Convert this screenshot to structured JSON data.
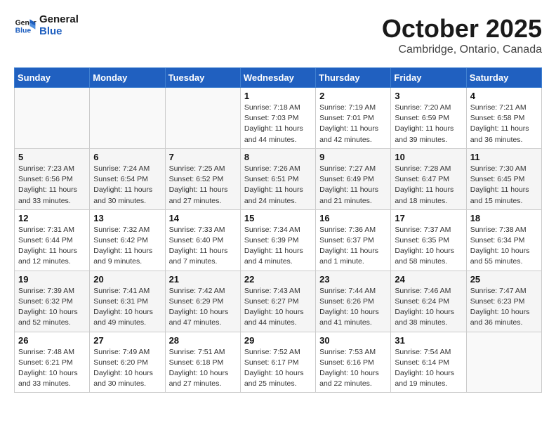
{
  "header": {
    "logo_line1": "General",
    "logo_line2": "Blue",
    "month_title": "October 2025",
    "location": "Cambridge, Ontario, Canada"
  },
  "days_of_week": [
    "Sunday",
    "Monday",
    "Tuesday",
    "Wednesday",
    "Thursday",
    "Friday",
    "Saturday"
  ],
  "weeks": [
    [
      {
        "num": "",
        "info": ""
      },
      {
        "num": "",
        "info": ""
      },
      {
        "num": "",
        "info": ""
      },
      {
        "num": "1",
        "info": "Sunrise: 7:18 AM\nSunset: 7:03 PM\nDaylight: 11 hours and 44 minutes."
      },
      {
        "num": "2",
        "info": "Sunrise: 7:19 AM\nSunset: 7:01 PM\nDaylight: 11 hours and 42 minutes."
      },
      {
        "num": "3",
        "info": "Sunrise: 7:20 AM\nSunset: 6:59 PM\nDaylight: 11 hours and 39 minutes."
      },
      {
        "num": "4",
        "info": "Sunrise: 7:21 AM\nSunset: 6:58 PM\nDaylight: 11 hours and 36 minutes."
      }
    ],
    [
      {
        "num": "5",
        "info": "Sunrise: 7:23 AM\nSunset: 6:56 PM\nDaylight: 11 hours and 33 minutes."
      },
      {
        "num": "6",
        "info": "Sunrise: 7:24 AM\nSunset: 6:54 PM\nDaylight: 11 hours and 30 minutes."
      },
      {
        "num": "7",
        "info": "Sunrise: 7:25 AM\nSunset: 6:52 PM\nDaylight: 11 hours and 27 minutes."
      },
      {
        "num": "8",
        "info": "Sunrise: 7:26 AM\nSunset: 6:51 PM\nDaylight: 11 hours and 24 minutes."
      },
      {
        "num": "9",
        "info": "Sunrise: 7:27 AM\nSunset: 6:49 PM\nDaylight: 11 hours and 21 minutes."
      },
      {
        "num": "10",
        "info": "Sunrise: 7:28 AM\nSunset: 6:47 PM\nDaylight: 11 hours and 18 minutes."
      },
      {
        "num": "11",
        "info": "Sunrise: 7:30 AM\nSunset: 6:45 PM\nDaylight: 11 hours and 15 minutes."
      }
    ],
    [
      {
        "num": "12",
        "info": "Sunrise: 7:31 AM\nSunset: 6:44 PM\nDaylight: 11 hours and 12 minutes."
      },
      {
        "num": "13",
        "info": "Sunrise: 7:32 AM\nSunset: 6:42 PM\nDaylight: 11 hours and 9 minutes."
      },
      {
        "num": "14",
        "info": "Sunrise: 7:33 AM\nSunset: 6:40 PM\nDaylight: 11 hours and 7 minutes."
      },
      {
        "num": "15",
        "info": "Sunrise: 7:34 AM\nSunset: 6:39 PM\nDaylight: 11 hours and 4 minutes."
      },
      {
        "num": "16",
        "info": "Sunrise: 7:36 AM\nSunset: 6:37 PM\nDaylight: 11 hours and 1 minute."
      },
      {
        "num": "17",
        "info": "Sunrise: 7:37 AM\nSunset: 6:35 PM\nDaylight: 10 hours and 58 minutes."
      },
      {
        "num": "18",
        "info": "Sunrise: 7:38 AM\nSunset: 6:34 PM\nDaylight: 10 hours and 55 minutes."
      }
    ],
    [
      {
        "num": "19",
        "info": "Sunrise: 7:39 AM\nSunset: 6:32 PM\nDaylight: 10 hours and 52 minutes."
      },
      {
        "num": "20",
        "info": "Sunrise: 7:41 AM\nSunset: 6:31 PM\nDaylight: 10 hours and 49 minutes."
      },
      {
        "num": "21",
        "info": "Sunrise: 7:42 AM\nSunset: 6:29 PM\nDaylight: 10 hours and 47 minutes."
      },
      {
        "num": "22",
        "info": "Sunrise: 7:43 AM\nSunset: 6:27 PM\nDaylight: 10 hours and 44 minutes."
      },
      {
        "num": "23",
        "info": "Sunrise: 7:44 AM\nSunset: 6:26 PM\nDaylight: 10 hours and 41 minutes."
      },
      {
        "num": "24",
        "info": "Sunrise: 7:46 AM\nSunset: 6:24 PM\nDaylight: 10 hours and 38 minutes."
      },
      {
        "num": "25",
        "info": "Sunrise: 7:47 AM\nSunset: 6:23 PM\nDaylight: 10 hours and 36 minutes."
      }
    ],
    [
      {
        "num": "26",
        "info": "Sunrise: 7:48 AM\nSunset: 6:21 PM\nDaylight: 10 hours and 33 minutes."
      },
      {
        "num": "27",
        "info": "Sunrise: 7:49 AM\nSunset: 6:20 PM\nDaylight: 10 hours and 30 minutes."
      },
      {
        "num": "28",
        "info": "Sunrise: 7:51 AM\nSunset: 6:18 PM\nDaylight: 10 hours and 27 minutes."
      },
      {
        "num": "29",
        "info": "Sunrise: 7:52 AM\nSunset: 6:17 PM\nDaylight: 10 hours and 25 minutes."
      },
      {
        "num": "30",
        "info": "Sunrise: 7:53 AM\nSunset: 6:16 PM\nDaylight: 10 hours and 22 minutes."
      },
      {
        "num": "31",
        "info": "Sunrise: 7:54 AM\nSunset: 6:14 PM\nDaylight: 10 hours and 19 minutes."
      },
      {
        "num": "",
        "info": ""
      }
    ]
  ]
}
